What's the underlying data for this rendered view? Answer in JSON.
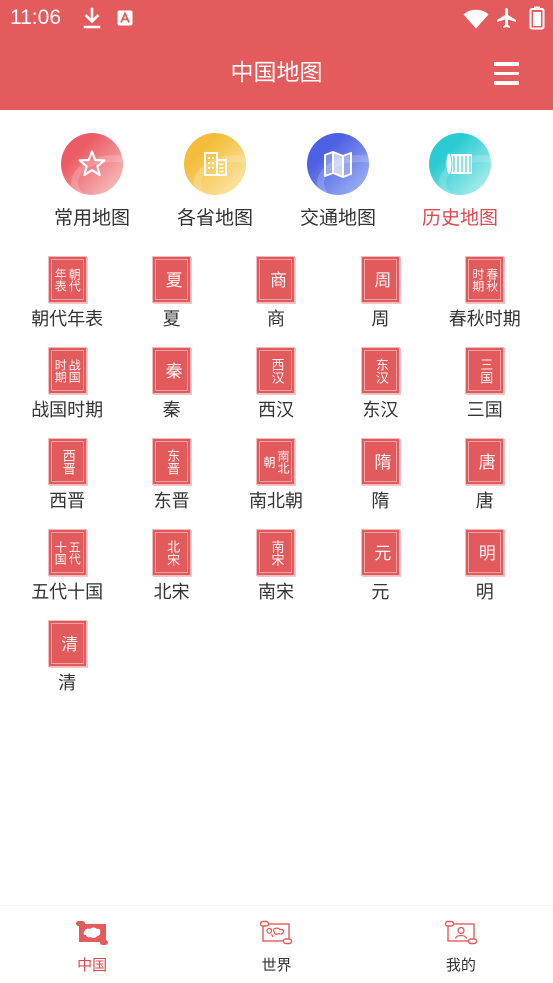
{
  "status_bar": {
    "time": "11:06",
    "icons": [
      "download-icon",
      "font-a-icon",
      "wifi-icon",
      "airplane-mode-icon",
      "battery-icon"
    ]
  },
  "header": {
    "title": "中国地图",
    "menu_icon": "hamburger-menu-icon"
  },
  "categories": [
    {
      "label": "常用地图",
      "icon": "star-icon",
      "active": false
    },
    {
      "label": "各省地图",
      "icon": "buildings-icon",
      "active": false
    },
    {
      "label": "交通地图",
      "icon": "folded-map-icon",
      "active": false
    },
    {
      "label": "历史地图",
      "icon": "scroll-icon",
      "active": true
    }
  ],
  "dynasties": [
    {
      "label": "朝代年表"
    },
    {
      "label": "夏"
    },
    {
      "label": "商"
    },
    {
      "label": "周"
    },
    {
      "label": "春秋时期"
    },
    {
      "label": "战国时期"
    },
    {
      "label": "秦"
    },
    {
      "label": "西汉"
    },
    {
      "label": "东汉"
    },
    {
      "label": "三国"
    },
    {
      "label": "西晋"
    },
    {
      "label": "东晋"
    },
    {
      "label": "南北朝"
    },
    {
      "label": "隋"
    },
    {
      "label": "唐"
    },
    {
      "label": "五代十国"
    },
    {
      "label": "北宋"
    },
    {
      "label": "南宋"
    },
    {
      "label": "元"
    },
    {
      "label": "明"
    },
    {
      "label": "清"
    }
  ],
  "bottom_nav": [
    {
      "label": "中国",
      "icon": "china-map-icon",
      "active": true
    },
    {
      "label": "世界",
      "icon": "world-map-icon",
      "active": false
    },
    {
      "label": "我的",
      "icon": "profile-icon",
      "active": false
    }
  ],
  "colors": {
    "primary": "#E35B5C",
    "active": "#E2474E",
    "text": "#333333"
  }
}
